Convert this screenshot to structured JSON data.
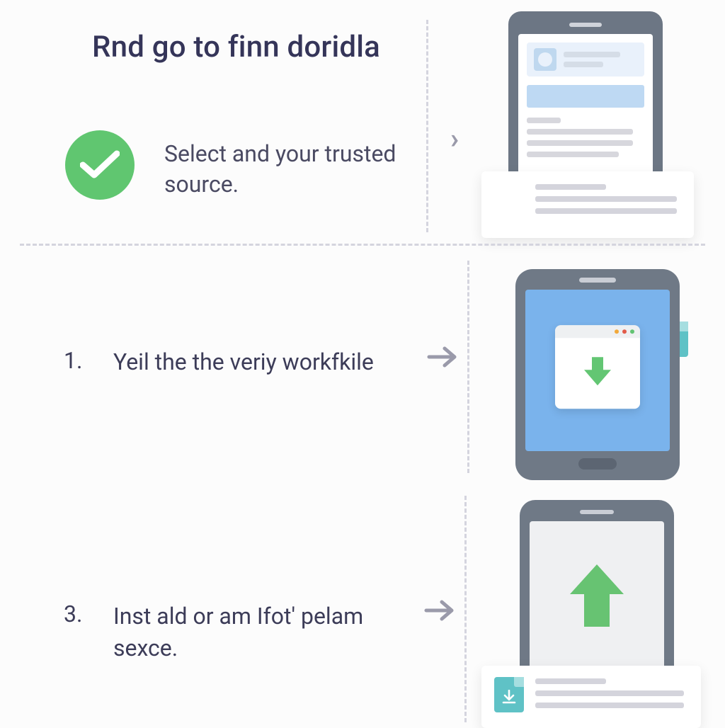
{
  "header": {
    "title": "Rnd go to finn doridla",
    "subtitle": "Select and your trusted source."
  },
  "steps": [
    {
      "number": "1.",
      "text": "Yeil the the veriy workfkile"
    },
    {
      "number": "3.",
      "text": "Inst ald or am Ifot' pelam sexce."
    }
  ],
  "icons": {
    "check": "check-icon",
    "chevron": "chevron-right-icon",
    "arrow_right": "arrow-right-icon",
    "download_file": "file-download-icon",
    "download_arrow": "download-arrow-icon",
    "upload_arrow": "upload-arrow-icon"
  },
  "colors": {
    "text": "#3b3b5c",
    "green": "#60c670",
    "teal": "#5fc2c6",
    "blue_screen": "#7ab3ec",
    "phone_body": "#6f7986",
    "dash": "#d4d4de"
  }
}
